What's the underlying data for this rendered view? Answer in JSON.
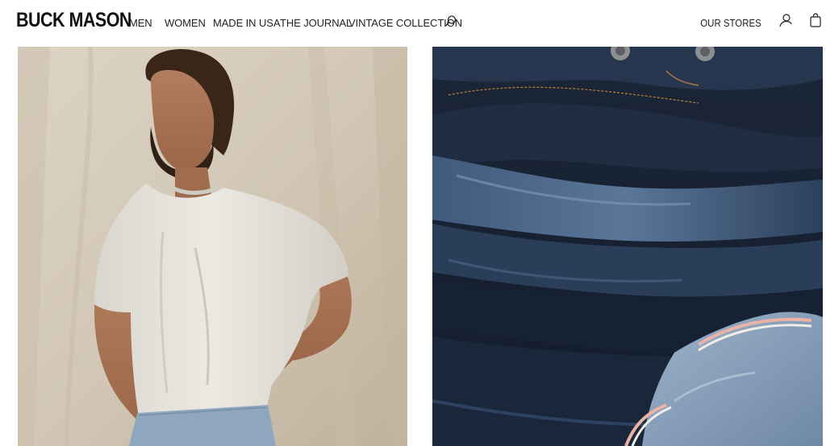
{
  "brand": {
    "logo_text": "BUCK MASON"
  },
  "nav": {
    "items": [
      {
        "label": "MEN"
      },
      {
        "label": "WOMEN"
      },
      {
        "label": "MADE IN USA"
      },
      {
        "label": "THE JOURNAL"
      },
      {
        "label": "VINTAGE COLLECTION"
      }
    ],
    "search_icon": "search-icon"
  },
  "utility": {
    "stores_label": "OUR STORES",
    "account_icon": "user-icon",
    "bag_icon": "shopping-bag-icon"
  },
  "hero": {
    "left_image": "man-in-white-tee-photo",
    "right_image": "folded-denim-jeans-photo"
  },
  "colors": {
    "text": "#1a1a1a",
    "background": "#ffffff",
    "backdrop": "#d3c9b8",
    "denim": "#1d2a3c"
  }
}
